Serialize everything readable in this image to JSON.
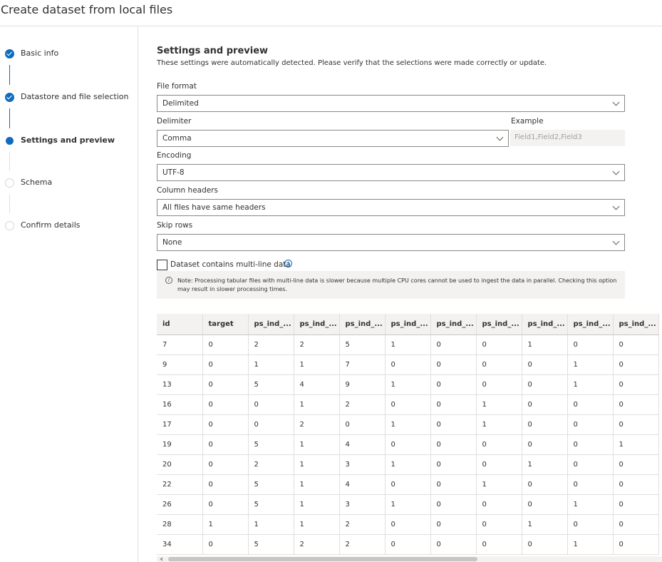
{
  "header": {
    "title": "Create dataset from local files"
  },
  "steps": [
    {
      "label": "Basic info",
      "state": "done"
    },
    {
      "label": "Datastore and file selection",
      "state": "done"
    },
    {
      "label": "Settings and preview",
      "state": "current"
    },
    {
      "label": "Schema",
      "state": "todo"
    },
    {
      "label": "Confirm details",
      "state": "todo"
    }
  ],
  "settings": {
    "title": "Settings and preview",
    "description": "These settings were automatically detected. Please verify that the selections were made correctly or update.",
    "file_format": {
      "label": "File format",
      "value": "Delimited"
    },
    "delimiter": {
      "label": "Delimiter",
      "value": "Comma"
    },
    "example": {
      "label": "Example",
      "value": "Field1,Field2,Field3"
    },
    "encoding": {
      "label": "Encoding",
      "value": "UTF-8"
    },
    "column_headers": {
      "label": "Column headers",
      "value": "All files have same headers"
    },
    "skip_rows": {
      "label": "Skip rows",
      "value": "None"
    },
    "multiline": {
      "label": "Dataset contains multi-line data",
      "checked": false
    },
    "note": "Note: Processing tabular files with multi-line data is slower because multiple CPU cores cannot be used to ingest the data in parallel. Checking this option may result in slower processing times."
  },
  "preview": {
    "columns": [
      "id",
      "target",
      "ps_ind_...",
      "ps_ind_...",
      "ps_ind_...",
      "ps_ind_...",
      "ps_ind_...",
      "ps_ind_...",
      "ps_ind_...",
      "ps_ind_...",
      "ps_ind_..."
    ],
    "rows": [
      [
        "7",
        "0",
        "2",
        "2",
        "5",
        "1",
        "0",
        "0",
        "1",
        "0",
        "0"
      ],
      [
        "9",
        "0",
        "1",
        "1",
        "7",
        "0",
        "0",
        "0",
        "0",
        "1",
        "0"
      ],
      [
        "13",
        "0",
        "5",
        "4",
        "9",
        "1",
        "0",
        "0",
        "0",
        "1",
        "0"
      ],
      [
        "16",
        "0",
        "0",
        "1",
        "2",
        "0",
        "0",
        "1",
        "0",
        "0",
        "0"
      ],
      [
        "17",
        "0",
        "0",
        "2",
        "0",
        "1",
        "0",
        "1",
        "0",
        "0",
        "0"
      ],
      [
        "19",
        "0",
        "5",
        "1",
        "4",
        "0",
        "0",
        "0",
        "0",
        "0",
        "1"
      ],
      [
        "20",
        "0",
        "2",
        "1",
        "3",
        "1",
        "0",
        "0",
        "1",
        "0",
        "0"
      ],
      [
        "22",
        "0",
        "5",
        "1",
        "4",
        "0",
        "0",
        "1",
        "0",
        "0",
        "0"
      ],
      [
        "26",
        "0",
        "5",
        "1",
        "3",
        "1",
        "0",
        "0",
        "0",
        "1",
        "0"
      ],
      [
        "28",
        "1",
        "1",
        "1",
        "2",
        "0",
        "0",
        "0",
        "1",
        "0",
        "0"
      ],
      [
        "34",
        "0",
        "5",
        "2",
        "2",
        "0",
        "0",
        "0",
        "0",
        "1",
        "0"
      ]
    ]
  },
  "colors": {
    "accent": "#0f6cbd",
    "border": "#8a8886",
    "muted_bg": "#f3f2f1"
  }
}
